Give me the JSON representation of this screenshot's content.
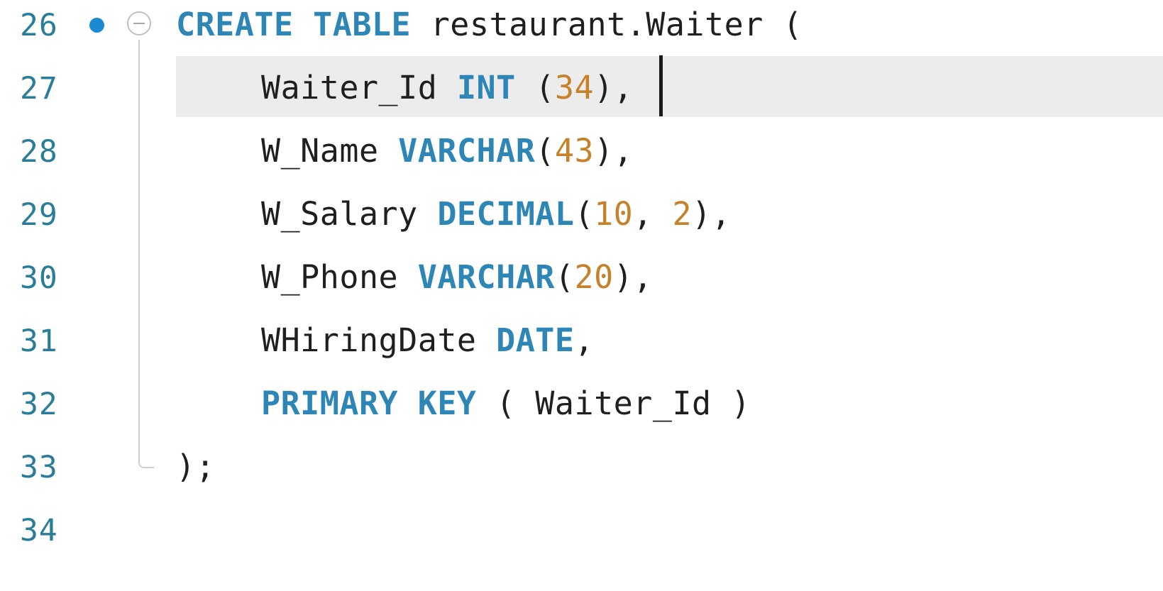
{
  "editor": {
    "lines": [
      {
        "number": "26",
        "has_breakpoint": true,
        "foldable": true,
        "tokens": [
          {
            "text": "CREATE",
            "kind": "keyword"
          },
          {
            "text": " ",
            "kind": "space"
          },
          {
            "text": "TABLE",
            "kind": "keyword"
          },
          {
            "text": " restaurant.Waiter (",
            "kind": "identifier"
          }
        ]
      },
      {
        "number": "27",
        "current": true,
        "tokens": [
          {
            "text": "Waiter_Id ",
            "kind": "identifier"
          },
          {
            "text": "INT",
            "kind": "keyword"
          },
          {
            "text": " (",
            "kind": "punct"
          },
          {
            "text": "34",
            "kind": "number"
          },
          {
            "text": "),",
            "kind": "punct"
          }
        ]
      },
      {
        "number": "28",
        "tokens": [
          {
            "text": "W_Name ",
            "kind": "identifier"
          },
          {
            "text": "VARCHAR",
            "kind": "keyword"
          },
          {
            "text": "(",
            "kind": "punct"
          },
          {
            "text": "43",
            "kind": "number"
          },
          {
            "text": "),",
            "kind": "punct"
          }
        ]
      },
      {
        "number": "29",
        "tokens": [
          {
            "text": "W_Salary ",
            "kind": "identifier"
          },
          {
            "text": "DECIMAL",
            "kind": "keyword"
          },
          {
            "text": "(",
            "kind": "punct"
          },
          {
            "text": "10",
            "kind": "number"
          },
          {
            "text": ", ",
            "kind": "punct"
          },
          {
            "text": "2",
            "kind": "number"
          },
          {
            "text": "),",
            "kind": "punct"
          }
        ]
      },
      {
        "number": "30",
        "tokens": [
          {
            "text": "W_Phone ",
            "kind": "identifier"
          },
          {
            "text": "VARCHAR",
            "kind": "keyword"
          },
          {
            "text": "(",
            "kind": "punct"
          },
          {
            "text": "20",
            "kind": "number"
          },
          {
            "text": "),",
            "kind": "punct"
          }
        ]
      },
      {
        "number": "31",
        "tokens": [
          {
            "text": "WHiringDate ",
            "kind": "identifier"
          },
          {
            "text": "DATE",
            "kind": "keyword"
          },
          {
            "text": ",",
            "kind": "punct"
          }
        ]
      },
      {
        "number": "32",
        "tokens": [
          {
            "text": "PRIMARY",
            "kind": "keyword"
          },
          {
            "text": " ",
            "kind": "space"
          },
          {
            "text": "KEY",
            "kind": "keyword"
          },
          {
            "text": " ( Waiter_Id )",
            "kind": "identifier"
          }
        ]
      },
      {
        "number": "33",
        "tokens": [
          {
            "text": ");",
            "kind": "punct"
          }
        ]
      },
      {
        "number": "34",
        "tokens": []
      }
    ]
  },
  "colors": {
    "keyword": "#2d86b5",
    "number": "#c5822b",
    "identifier": "#1f1f1f",
    "line_number": "#2a7d99",
    "breakpoint": "#1a8ad4",
    "current_line_highlight": "#ececec"
  },
  "icons": {
    "breakpoint": "breakpoint-dot-icon",
    "fold": "collapse-minus-icon"
  }
}
